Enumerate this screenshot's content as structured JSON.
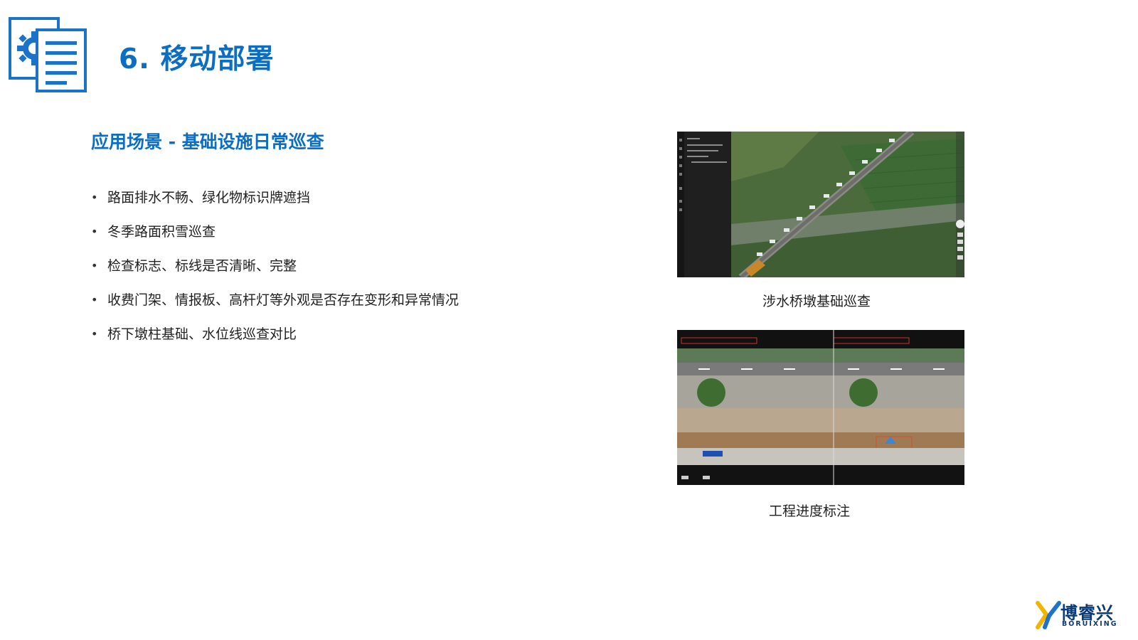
{
  "header": {
    "icon": "document-gear-icon",
    "title": "6. 移动部署"
  },
  "section": {
    "title": "应用场景 - 基础设施日常巡查"
  },
  "bullets": [
    "路面排水不畅、绿化物标识牌遮挡",
    "冬季路面积雪巡查",
    "检查标志、标线是否清晰、完整",
    "收费门架、情报板、高杆灯等外观是否存在变形和异常情况",
    "桥下墩柱基础、水位线巡查对比"
  ],
  "figures": [
    {
      "image": "aerial-map-screenshot",
      "caption": "涉水桥墩基础巡查"
    },
    {
      "image": "side-by-side-comparison-screenshot",
      "caption": "工程进度标注"
    }
  ],
  "logo": {
    "name_cn": "博睿兴",
    "name_en": "BORUIXING"
  },
  "colors": {
    "accent": "#0b6ec3",
    "text": "#222222",
    "logo": "#0b3a78"
  }
}
